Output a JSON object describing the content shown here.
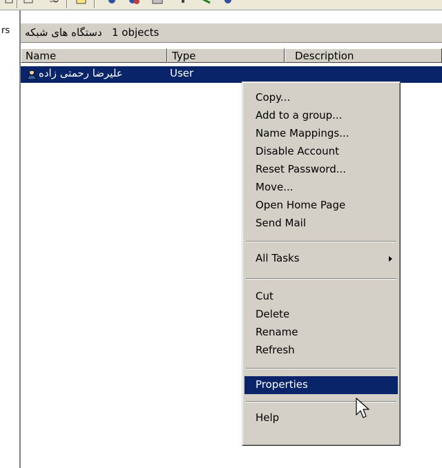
{
  "header": {
    "network_devices_label": "دستگاه های شبکه",
    "objects_count": "1 objects"
  },
  "left_fragment": "rs",
  "columns": [
    "Name",
    "Type",
    "Description"
  ],
  "rows": [
    {
      "name": "علیرضا رحمتی زاده",
      "type": "User",
      "description": ""
    }
  ],
  "context_menu": {
    "items": [
      {
        "label": "Copy..."
      },
      {
        "label": "Add to a group..."
      },
      {
        "label": "Name Mappings..."
      },
      {
        "label": "Disable Account"
      },
      {
        "label": "Reset Password..."
      },
      {
        "label": "Move..."
      },
      {
        "label": "Open Home Page"
      },
      {
        "label": "Send Mail"
      },
      {
        "label": "All Tasks"
      },
      {
        "label": "Cut"
      },
      {
        "label": "Delete"
      },
      {
        "label": "Rename"
      },
      {
        "label": "Refresh"
      },
      {
        "label": "Properties"
      },
      {
        "label": "Help"
      }
    ],
    "highlighted": "Properties"
  },
  "icons": {
    "user": "user-icon",
    "submenu": "submenu-arrow-icon",
    "cursor": "mouse-pointer-icon"
  },
  "colors": {
    "selection": "#0a246a",
    "menu_bg": "#d4d0c8"
  }
}
